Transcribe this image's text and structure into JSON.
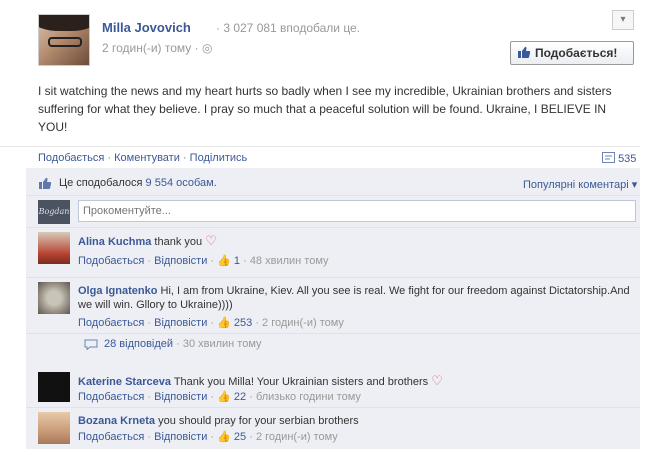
{
  "post": {
    "author": "Milla Jovovich",
    "likes_header": "· 3 027 081 вподобали це.",
    "time": "2 годин(-и) тому ·",
    "like_page_button": "Подобається!",
    "text": "I sit watching the news and my heart hurts so badly when I see my incredible, Ukrainian brothers and sisters suffering for what they believe. I pray so much that a peaceful solution will be found. Ukraine, I BELIEVE IN YOU!"
  },
  "actions": {
    "like": "Подобається",
    "comment": "Коментувати",
    "share": "Поділитись",
    "shares_count": "535"
  },
  "likes": {
    "prefix": "Це сподобалося",
    "count": "9 554 особам.",
    "sort": "Популярні коментарі ▾"
  },
  "composer": {
    "placeholder": "Прокоментуйте...",
    "avatar_text": "Bogdan"
  },
  "comments": [
    {
      "name": "Alina Kuchma",
      "text": "thank you",
      "heart": "♡",
      "like": "Подобається",
      "reply": "Відповісти",
      "likes": "1",
      "time": "48 хвилин тому"
    },
    {
      "name": "Olga Ignatenko",
      "text": "Hi, I am from Ukraine, Kiev. All you see is real. We fight for our freedom against Dictatorship.And we will win. Gllory to Ukraine))))",
      "like": "Подобається",
      "reply": "Відповісти",
      "likes": "253",
      "time": "2 годин(-и) тому"
    },
    {
      "name": "Katerine Starceva",
      "text": "Thank you Milla! Your Ukrainian sisters and brothers",
      "heart": "♡",
      "like": "Подобається",
      "reply": "Відповісти",
      "likes": "22",
      "time": "близько години тому"
    },
    {
      "name": "Bozana Krneta",
      "text": "you should pray for your serbian brothers",
      "like": "Подобається",
      "reply": "Відповісти",
      "likes": "25",
      "time": "2 годин(-и) тому"
    }
  ],
  "replies": {
    "count": "28 відповідей",
    "time": "· 30 хвилин тому"
  },
  "colors": {
    "link": "#3b5998",
    "feedback_bg": "#edeff4",
    "heart": "#e05a7a"
  }
}
